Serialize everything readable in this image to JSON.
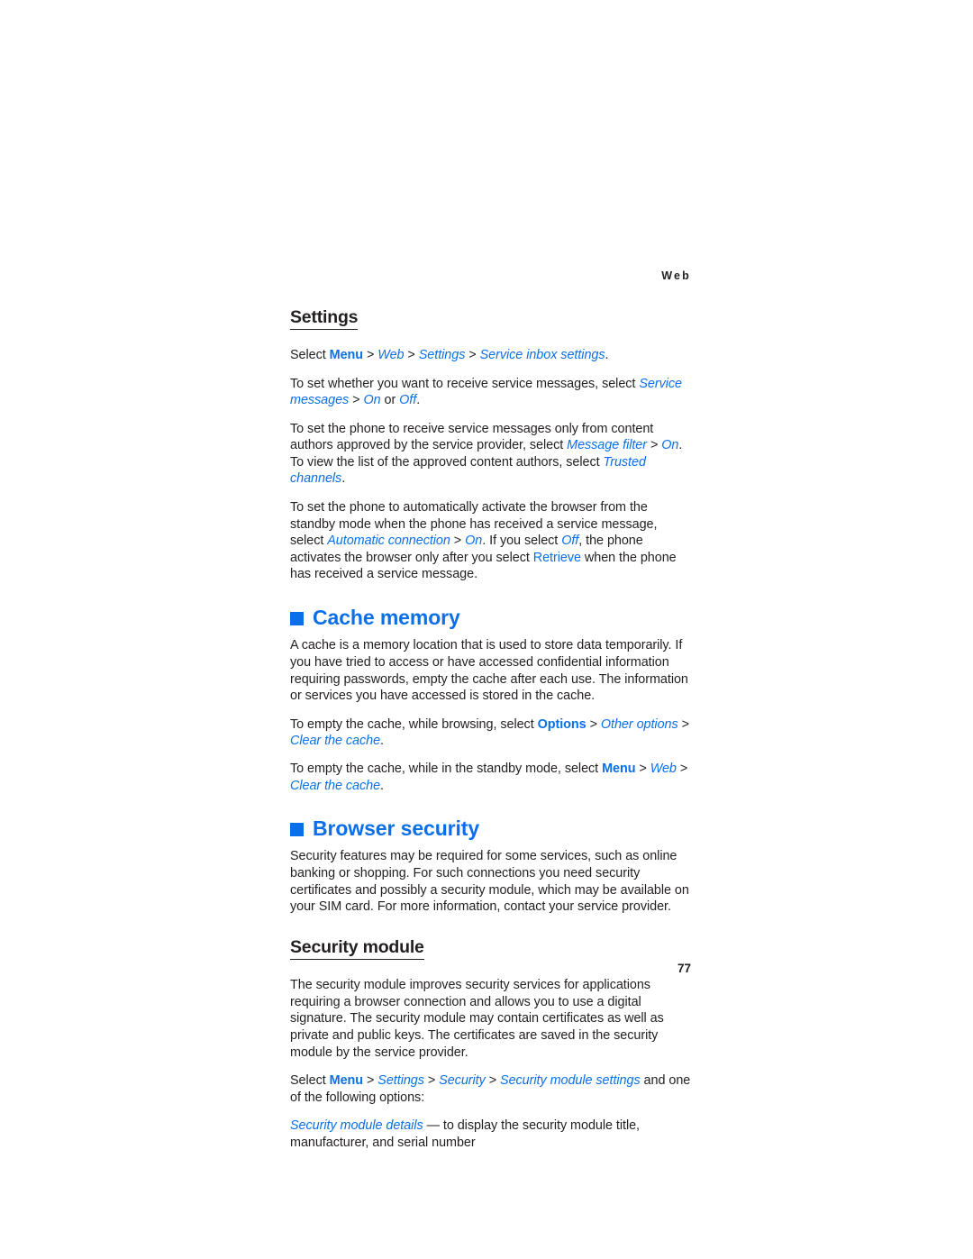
{
  "page": {
    "running_head": "Web",
    "folio": "77",
    "accent_color": "#0b6fe8",
    "text_color": "#231f20"
  },
  "sections": {
    "settings": {
      "heading": "Settings",
      "select_line": {
        "lead": "Select ",
        "menu": "Menu",
        "sep1": " > ",
        "web": "Web",
        "sep2": " > ",
        "settings": "Settings",
        "sep3": " > ",
        "service_inbox_settings": "Service inbox settings",
        "period": "."
      },
      "para_service_messages": {
        "lead": "To set whether you want to receive service messages, select ",
        "service_messages": "Service messages",
        "sep": " > ",
        "on": "On",
        "mid": " or ",
        "off": "Off",
        "period": "."
      },
      "para_message_filter": {
        "lead": "To set the phone to receive service messages only from content authors approved by the service provider, select ",
        "message_filter": "Message filter",
        "sep": " > ",
        "on": "On",
        "mid": ". To view the list of the approved content authors, select ",
        "trusted_channels": "Trusted channels",
        "period": "."
      },
      "para_automatic_connection": {
        "lead": "To set the phone to automatically activate the browser from the standby mode when the phone has received a service message, select ",
        "automatic_connection": "Automatic connection",
        "sep": " > ",
        "on": "On",
        "mid1": ". If you select ",
        "off": "Off",
        "mid2": ", the phone activates the browser only after you select ",
        "retrieve": "Retrieve",
        "tail": " when the phone has received a service message."
      }
    },
    "cache_memory": {
      "heading": "Cache memory",
      "para_intro": "A cache is a memory location that is used to store data temporarily. If you have tried to access or have accessed confidential information requiring passwords, empty the cache after each use. The information or services you have accessed is stored in the cache.",
      "para_browsing": {
        "lead": "To empty the cache, while browsing, select ",
        "options": "Options",
        "sep1": " > ",
        "other_options": "Other options",
        "sep2": " > ",
        "clear_the_cache": "Clear the cache",
        "period": "."
      },
      "para_standby": {
        "lead": "To empty the cache, while in the standby mode, select ",
        "menu": "Menu",
        "sep1": " > ",
        "web": "Web",
        "sep2": " > ",
        "clear_the_cache": "Clear the cache",
        "period": "."
      }
    },
    "browser_security": {
      "heading": "Browser security",
      "para_intro": "Security features may be required for some services, such as online banking or shopping. For such connections you need security certificates and possibly a security module, which may be available on your SIM card. For more information, contact your service provider.",
      "security_module": {
        "heading": "Security module",
        "para_intro": "The security module improves security services for applications requiring a browser connection and allows you to use a digital signature. The security module may contain certificates as well as private and public keys. The certificates are saved in the security module by the service provider.",
        "select_line": {
          "lead": "Select ",
          "menu": "Menu",
          "sep1": " > ",
          "settings": "Settings",
          "sep2": " > ",
          "security": "Security",
          "sep3": " > ",
          "security_module_settings": "Security module settings",
          "tail": " and one of the following options:"
        },
        "option_details": {
          "term": "Security module details",
          "definition": " — to display the security module title, manufacturer, and serial number"
        }
      }
    }
  }
}
